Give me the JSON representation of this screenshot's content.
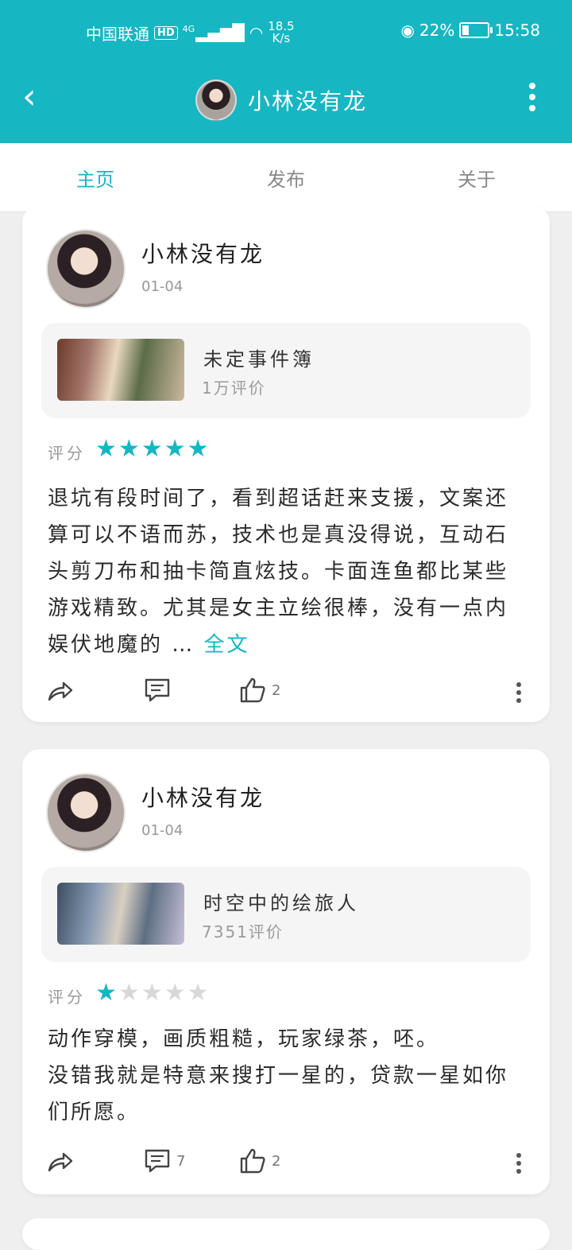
{
  "status_bar": {
    "carrier": "中国联通",
    "hd": "HD",
    "network": "4G",
    "speed_value": "18.5",
    "speed_unit": "K/s",
    "battery": "22%",
    "time": "15:58"
  },
  "header": {
    "title": "小林没有龙"
  },
  "tabs": [
    {
      "label": "主页",
      "active": true
    },
    {
      "label": "发布",
      "active": false
    },
    {
      "label": "关于",
      "active": false
    }
  ],
  "posts": [
    {
      "author": "小林没有龙",
      "date": "01-04",
      "game": {
        "name": "未定事件簿",
        "reviews": "1万评价"
      },
      "rating_label": "评分",
      "rating": 5,
      "review": "退坑有段时间了，看到超话赶来支援，文案还算可以不语而苏，技术也是真没得说，互动石头剪刀布和抽卡简直炫技。卡面连鱼都比某些游戏精致。尤其是女主立绘很棒，没有一点内娱伏地魔的",
      "ellipsis": " … ",
      "more_label": "全文",
      "comments": "",
      "likes": "2"
    },
    {
      "author": "小林没有龙",
      "date": "01-04",
      "game": {
        "name": "时空中的绘旅人",
        "reviews": "7351评价"
      },
      "rating_label": "评分",
      "rating": 1,
      "review_lines": [
        "动作穿模，画质粗糙，玩家绿茶，呸。",
        "没错我就是特意来搜打一星的，贷款一星如你们所愿。"
      ],
      "comments": "7",
      "likes": "2"
    }
  ],
  "colors": {
    "accent": "#16b6c3",
    "background": "#efefef",
    "card": "#ffffff"
  },
  "icons": [
    "back-arrow-icon",
    "more-vertical-icon",
    "share-icon",
    "comment-icon",
    "like-icon",
    "star-icon"
  ]
}
